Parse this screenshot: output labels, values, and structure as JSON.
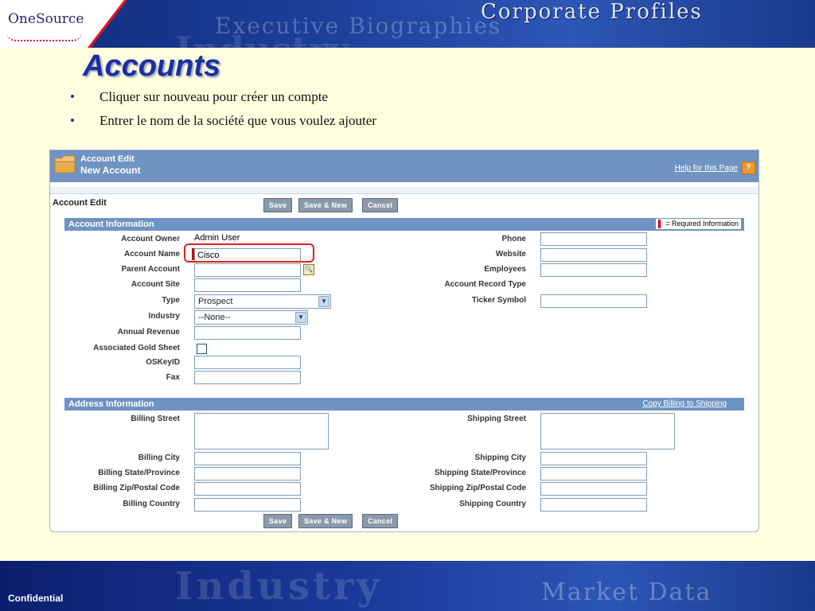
{
  "banner": {
    "logo_text": "OneSource",
    "title": "Corporate Profiles",
    "bg_word_1": "Executive Biographies",
    "bg_word_2": "Industry"
  },
  "slide": {
    "title": "Accounts",
    "bullets": [
      "Cliquer sur nouveau pour créer un compte",
      "Entrer le nom de la société que vous voulez ajouter"
    ]
  },
  "form_header": {
    "line1": "Account Edit",
    "line2": "New Account",
    "help_link": "Help for this Page",
    "help_icon": "?"
  },
  "edit_section": {
    "title": "Account Edit",
    "buttons": {
      "save": "Save",
      "save_new": "Save & New",
      "cancel": "Cancel"
    }
  },
  "account_info": {
    "title": "Account Information",
    "required_legend": "= Required Information",
    "left": {
      "account_owner": {
        "label": "Account Owner",
        "value": "Admin User"
      },
      "account_name": {
        "label": "Account Name",
        "value": "Cisco"
      },
      "parent_account": {
        "label": "Parent Account",
        "value": ""
      },
      "account_site": {
        "label": "Account Site",
        "value": ""
      },
      "type": {
        "label": "Type",
        "value": "Prospect"
      },
      "industry": {
        "label": "Industry",
        "value": "--None--"
      },
      "annual_revenue": {
        "label": "Annual Revenue",
        "value": ""
      },
      "gold_sheet": {
        "label": "Associated Gold Sheet"
      },
      "oskeyid": {
        "label": "OSKeyID",
        "value": ""
      },
      "fax": {
        "label": "Fax",
        "value": ""
      }
    },
    "right": {
      "phone": {
        "label": "Phone",
        "value": ""
      },
      "website": {
        "label": "Website",
        "value": ""
      },
      "employees": {
        "label": "Employees",
        "value": ""
      },
      "record_type": {
        "label": "Account Record Type"
      },
      "ticker": {
        "label": "Ticker Symbol",
        "value": ""
      }
    }
  },
  "address_info": {
    "title": "Address Information",
    "copy_link": "Copy Billing to Shipping",
    "billing": {
      "street": "Billing Street",
      "city": "Billing City",
      "state": "Billing State/Province",
      "zip": "Billing Zip/Postal Code",
      "country": "Billing Country"
    },
    "shipping": {
      "street": "Shipping Street",
      "city": "Shipping City",
      "state": "Shipping State/Province",
      "zip": "Shipping Zip/Postal Code",
      "country": "Shipping Country"
    }
  },
  "footer": {
    "label": "Confidential",
    "bg_word_1": "Industry",
    "bg_word_2": "Market Data"
  },
  "colors": {
    "slide_bg": "#ffffdf",
    "title_blue": "#1a2fa0",
    "section_bar": "#6f93c2",
    "required_red": "#cc0000",
    "highlight_red": "#e02020"
  }
}
